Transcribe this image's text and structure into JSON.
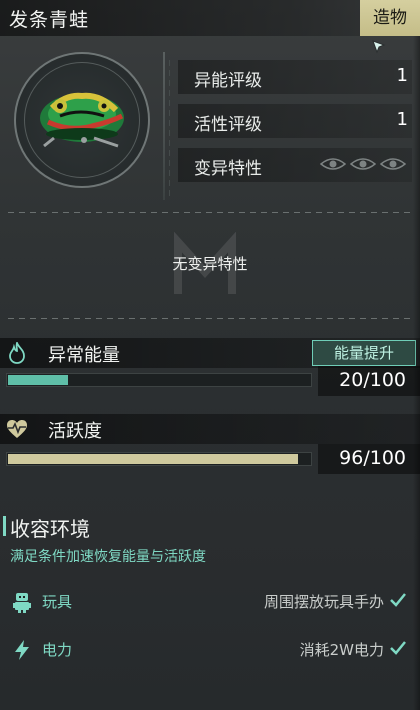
{
  "header": {
    "title": "发条青蛙",
    "tag": "造物"
  },
  "portrait": {
    "subject_icon": "wind-up-frog-icon"
  },
  "stats": [
    {
      "label": "异能评级",
      "value": "1"
    },
    {
      "label": "活性评级",
      "value": "1"
    },
    {
      "label": "变异特性",
      "value_icon": "eye-icon"
    }
  ],
  "mutation": {
    "empty_text": "无变异特性"
  },
  "energy": {
    "label": "异常能量",
    "icon": "flame-icon",
    "button_label": "能量提升",
    "value_text": "20/100",
    "current": 20,
    "max": 100,
    "fill_color": "#5fbfa8"
  },
  "activity": {
    "label": "活跃度",
    "icon": "heart-pulse-icon",
    "value_text": "96/100",
    "current": 96,
    "max": 100,
    "fill_color": "#cfc99d"
  },
  "containment": {
    "title": "收容环境",
    "subtitle": "满足条件加速恢复能量与活跃度",
    "conditions": [
      {
        "name": "玩具",
        "icon": "toy-robot-icon",
        "desc": "周围摆放玩具手办",
        "met": true
      },
      {
        "name": "电力",
        "icon": "lightning-icon",
        "desc": "消耗2W电力",
        "met": true
      }
    ]
  },
  "colors": {
    "accent": "#7fd9c4",
    "tag_bg": "#d5cf9f"
  }
}
